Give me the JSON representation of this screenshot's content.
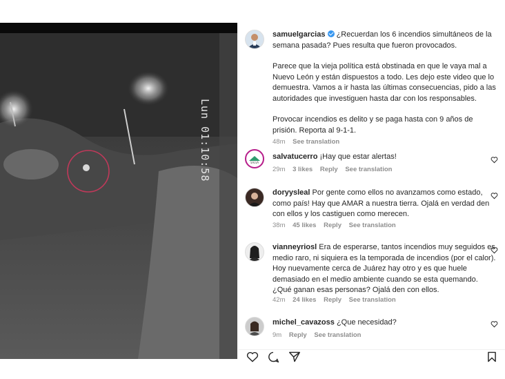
{
  "post": {
    "username": "samuelgarcias",
    "verified": true,
    "caption_line1": "¿Recuerdan los 6 incendios simultáneos de la semana pasada? Pues resulta que fueron provocados.",
    "caption_para2": "Parece que la vieja política está obstinada en que le vaya mal a Nuevo León y están dispuestos a todo. Les dejo este video que lo demuestra. Vamos a ir hasta las últimas consecuencias, pido a las autoridades que investiguen hasta dar con los responsables.",
    "caption_para3": "Provocar incendios es delito y se paga hasta con 9 años de prisión. Reporta al 9-1-1.",
    "time": "48m",
    "see_translation": "See translation"
  },
  "video": {
    "timestamp_overlay": "Lun 01:10:58"
  },
  "comments": [
    {
      "username": "salvatucerro",
      "text": "¡Hay que estar alertas!",
      "time": "29m",
      "likes": "3 likes",
      "reply": "Reply",
      "see_translation": "See translation"
    },
    {
      "username": "doryysleal",
      "text": "Por gente como ellos no avanzamos como estado, como país! Hay que AMAR a nuestra tierra. Ojalá en verdad den con ellos y los castiguen como merecen.",
      "time": "38m",
      "likes": "45 likes",
      "reply": "Reply",
      "see_translation": "See translation"
    },
    {
      "username": "vianneyriosl",
      "text": "Era de esperarse, tantos incendios muy seguidos es medio raro, ni siquiera es la temporada de incendios (por el calor). Hoy nuevamente cerca de Juárez hay otro y es que huele demasiado en el medio ambiente cuando se esta quemando. ¿Qué ganan esas personas? Ojalá den con ellos.",
      "time": "42m",
      "likes": "24 likes",
      "reply": "Reply",
      "see_translation": "See translation"
    },
    {
      "username": "michel_cavazoss",
      "text": "¿Que necesidad?",
      "time": "9m",
      "likes": "",
      "reply": "Reply",
      "see_translation": "See translation"
    }
  ],
  "colors": {
    "text": "#262626",
    "meta": "#8e8e8e",
    "verified": "#3897f0"
  },
  "icons": [
    "like-icon",
    "comment-icon",
    "share-icon",
    "save-icon",
    "comment-like-icon",
    "verified-badge-icon"
  ]
}
